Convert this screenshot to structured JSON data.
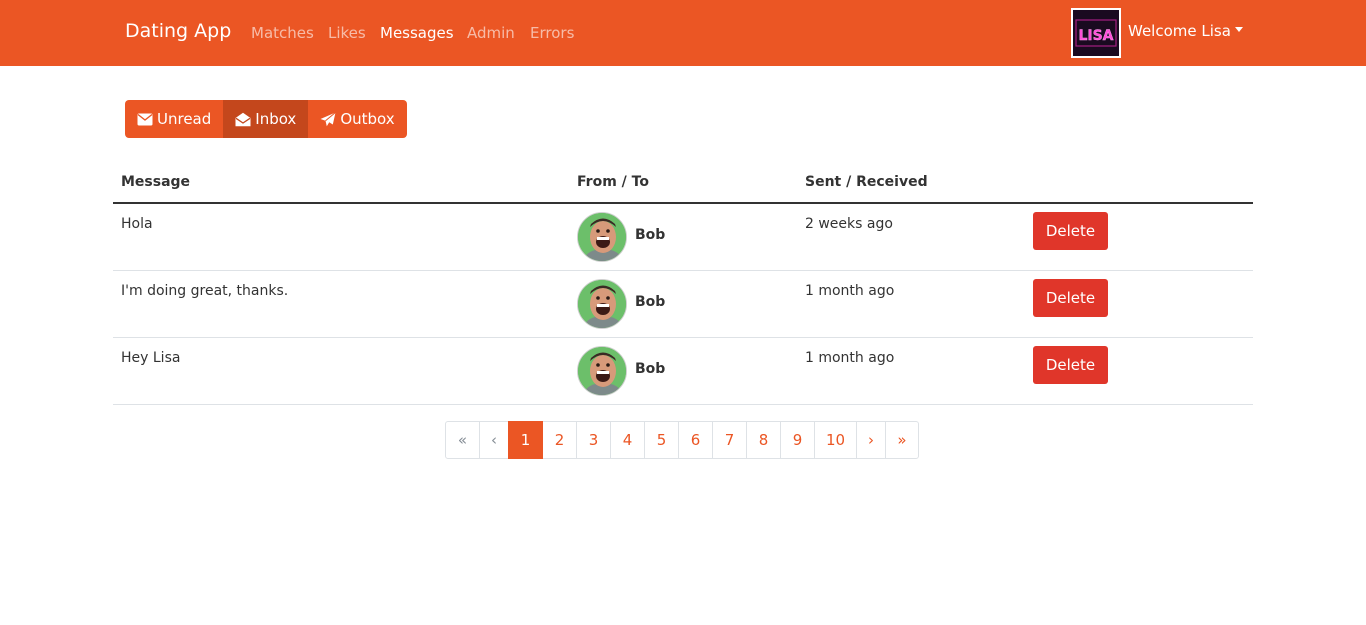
{
  "navbar": {
    "brand": "Dating App",
    "links": [
      {
        "label": "Matches",
        "active": false
      },
      {
        "label": "Likes",
        "active": false
      },
      {
        "label": "Messages",
        "active": true
      },
      {
        "label": "Admin",
        "active": false
      },
      {
        "label": "Errors",
        "active": false
      }
    ],
    "user_photo_text": "LISA",
    "welcome": "Welcome Lisa"
  },
  "message_tabs": [
    {
      "label": "Unread",
      "icon": "envelope-icon",
      "active": false
    },
    {
      "label": "Inbox",
      "icon": "envelope-open-icon",
      "active": true
    },
    {
      "label": "Outbox",
      "icon": "paper-plane-icon",
      "active": false
    }
  ],
  "table": {
    "headers": [
      "Message",
      "From / To",
      "Sent / Received"
    ],
    "rows": [
      {
        "message": "Hola",
        "user": "Bob",
        "when": "2 weeks ago",
        "action": "Delete"
      },
      {
        "message": "I'm doing great, thanks.",
        "user": "Bob",
        "when": "1 month ago",
        "action": "Delete"
      },
      {
        "message": "Hey Lisa",
        "user": "Bob",
        "when": "1 month ago",
        "action": "Delete"
      }
    ]
  },
  "pagination": {
    "first": "«",
    "prev": "‹",
    "pages": [
      "1",
      "2",
      "3",
      "4",
      "5",
      "6",
      "7",
      "8",
      "9",
      "10"
    ],
    "current": "1",
    "next": "›",
    "last": "»"
  },
  "colors": {
    "primary": "#eb5624",
    "primary_active": "#c4471c",
    "danger": "#e0362a"
  }
}
